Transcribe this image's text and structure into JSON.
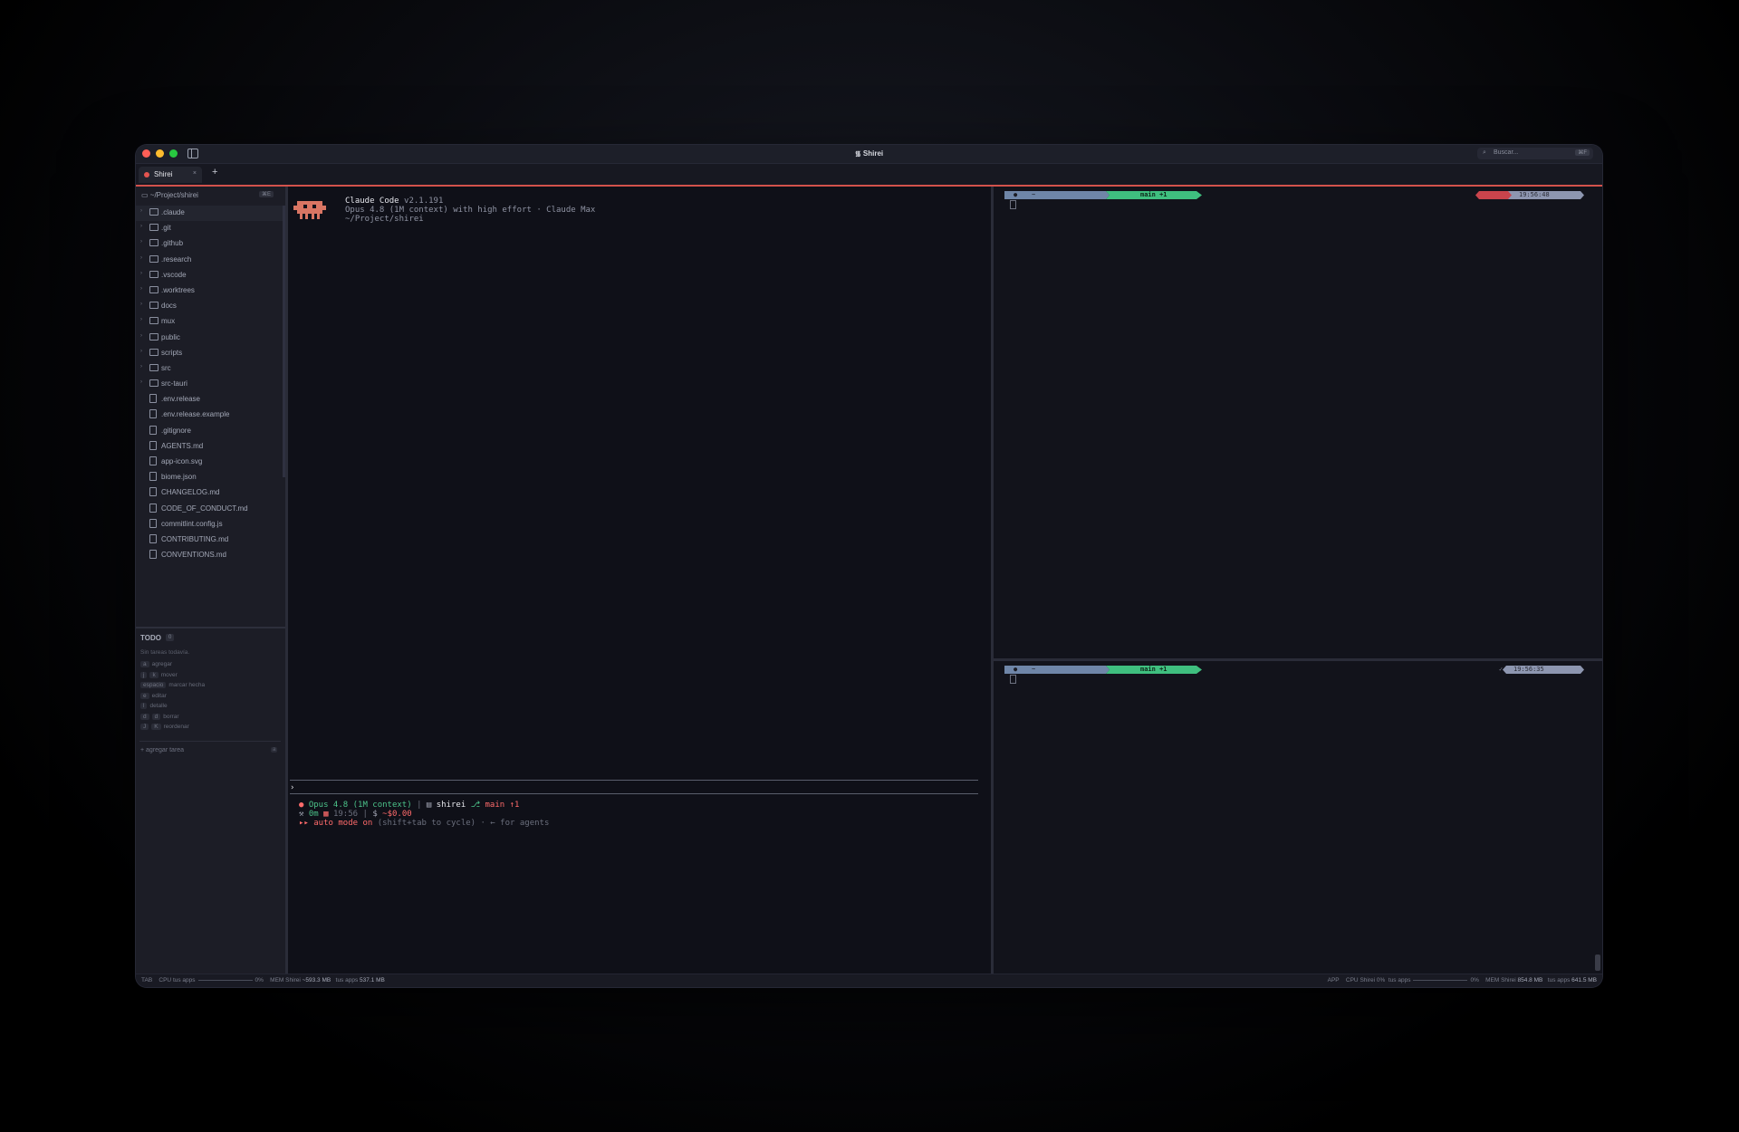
{
  "window": {
    "title": "᯾ Shirei"
  },
  "search": {
    "placeholder": "Buscar...",
    "shortcut": "⌘F"
  },
  "tabs": [
    {
      "label": "Shirei",
      "close": "×"
    }
  ],
  "new_tab": "+",
  "sidebar": {
    "path": "~/Project/shirei",
    "path_kbd": "⌘E",
    "items": [
      {
        "name": ".claude",
        "type": "folder",
        "selected": true
      },
      {
        "name": ".git",
        "type": "folder"
      },
      {
        "name": ".github",
        "type": "folder"
      },
      {
        "name": ".research",
        "type": "folder"
      },
      {
        "name": ".vscode",
        "type": "folder"
      },
      {
        "name": ".worktrees",
        "type": "folder"
      },
      {
        "name": "docs",
        "type": "folder"
      },
      {
        "name": "mux",
        "type": "folder"
      },
      {
        "name": "public",
        "type": "folder"
      },
      {
        "name": "scripts",
        "type": "folder"
      },
      {
        "name": "src",
        "type": "folder"
      },
      {
        "name": "src-tauri",
        "type": "folder"
      },
      {
        "name": ".env.release",
        "type": "file"
      },
      {
        "name": ".env.release.example",
        "type": "file"
      },
      {
        "name": ".gitignore",
        "type": "file"
      },
      {
        "name": "AGENTS.md",
        "type": "file"
      },
      {
        "name": "app-icon.svg",
        "type": "file"
      },
      {
        "name": "biome.json",
        "type": "file"
      },
      {
        "name": "CHANGELOG.md",
        "type": "file"
      },
      {
        "name": "CODE_OF_CONDUCT.md",
        "type": "file"
      },
      {
        "name": "commitlint.config.js",
        "type": "file"
      },
      {
        "name": "CONTRIBUTING.md",
        "type": "file"
      },
      {
        "name": "CONVENTIONS.md",
        "type": "file"
      }
    ]
  },
  "todo": {
    "title": "TODO",
    "count": "0",
    "empty": "Sin tareas todavía.",
    "hints": [
      {
        "keys": [
          "a"
        ],
        "label": "agregar"
      },
      {
        "keys": [
          "j",
          "k"
        ],
        "label": "mover"
      },
      {
        "keys": [
          "espacio"
        ],
        "label": "marcar hecha"
      },
      {
        "keys": [
          "e"
        ],
        "label": "editar"
      },
      {
        "keys": [
          "l"
        ],
        "label": "detalle"
      },
      {
        "keys": [
          "d",
          "d"
        ],
        "label": "borrar"
      },
      {
        "keys": [
          "J",
          "K"
        ],
        "label": "reordenar"
      }
    ],
    "add": "+ agregar tarea",
    "add_kbd": "a"
  },
  "claude": {
    "title": "Claude Code",
    "version": "v2.1.191",
    "model_line": "Opus 4.8 (1M context) with high effort · Claude Max",
    "cwd": "~/Project/shirei",
    "prompt_caret": "›",
    "status": {
      "model": "Opus 4.8 (1M context)",
      "sep": "|",
      "dir": "shirei",
      "branch": "main ↑1",
      "time_spent": "0m",
      "clock": "19:56",
      "cost": "~$0.00",
      "mode_label": "auto mode on",
      "mode_hint": "(shift+tab to cycle) · ← for agents",
      "mode_arrows": "▸▸"
    },
    "mascot_color": "#d97563"
  },
  "terminals": [
    {
      "dir": "~",
      "branch": "main +1",
      "time": "19:56:48",
      "status_color": "#c9444c"
    },
    {
      "dir": "~",
      "branch": "main +1",
      "time": "19:56:35",
      "check": "✓",
      "status_color": "#8d96b0"
    }
  ],
  "statusbar": {
    "left_label": "TAB",
    "left_cpu": "CPU",
    "left_cpu_apps": "tus apps",
    "left_cpu_pct": "0%",
    "left_mem": "MEM",
    "left_mem_shirei_label": "Shirei",
    "left_mem_shirei": "~593.3 MB",
    "left_mem_apps_label": "tus apps",
    "left_mem_apps": "537.1 MB",
    "right_label": "APP",
    "right_cpu": "CPU",
    "right_cpu_shirei": "Shirei 0%",
    "right_cpu_apps": "tus apps",
    "right_cpu_pct": "0%",
    "right_mem": "MEM",
    "right_mem_shirei_label": "Shirei",
    "right_mem_shirei": "854.8 MB",
    "right_mem_apps_label": "tus apps",
    "right_mem_apps": "641.5 MB"
  },
  "colors": {
    "accent": "#d3524c",
    "branch_green": "#3fbf7f",
    "pane_bg": "#12131b"
  }
}
